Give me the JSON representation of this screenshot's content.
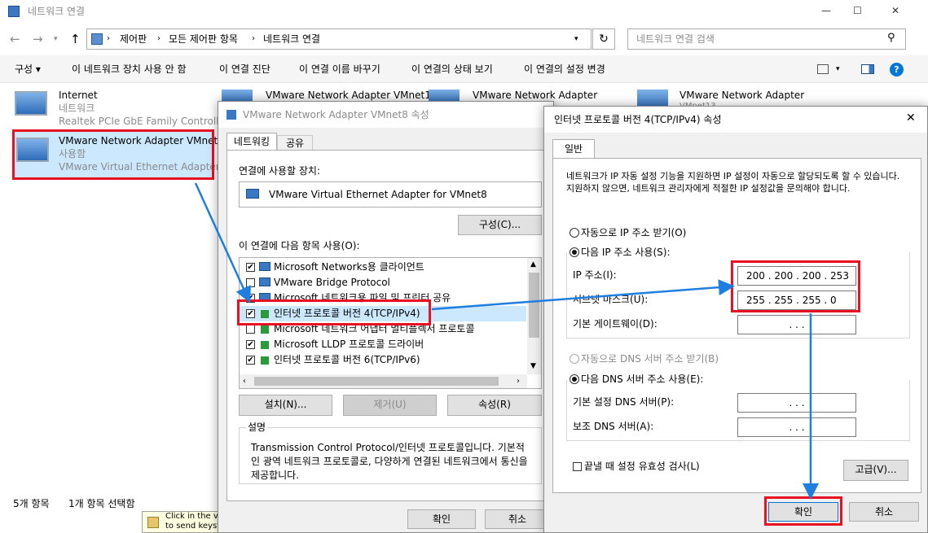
{
  "window": {
    "title": "네트워크 연결",
    "min": "—",
    "max": "☐",
    "close": "✕"
  },
  "address": {
    "path": [
      "제어판",
      "모든 제어판 항목",
      "네트워크 연결"
    ],
    "search_placeholder": "네트워크 연결 검색"
  },
  "commands": [
    "구성 ▾",
    "이 네트워크 장치 사용 안 함",
    "이 연결 진단",
    "이 연결 이름 바꾸기",
    "이 연결의 상태 보기",
    "이 연결의 설정 변경"
  ],
  "adapters": [
    {
      "name": "Internet",
      "status": "네트워크",
      "device": "Realtek PCIe GbE Family Controller"
    },
    {
      "name": "VMware Network Adapter VMnet8",
      "status": "사용함",
      "device": "VMware Virtual Ethernet Adapter..."
    },
    {
      "name": "VMware Network Adapter VMnet1"
    },
    {
      "name": "VMware Network Adapter"
    },
    {
      "name": "VMware Network Adapter",
      "extra": "VMnet13"
    }
  ],
  "statusbar": {
    "count": "5개 항목",
    "selected": "1개 항목 선택함"
  },
  "taskbar_text": {
    "line1": "Click in the vi",
    "line2": "to send keyst"
  },
  "props": {
    "title": "VMware Network Adapter VMnet8 속성",
    "tabs": [
      "네트워킹",
      "공유"
    ],
    "connect_using_label": "연결에 사용할 장치:",
    "device": "VMware Virtual Ethernet Adapter for VMnet8",
    "configure": "구성(C)...",
    "items_label": "이 연결에 다음 항목 사용(O):",
    "items": [
      {
        "label": "Microsoft Networks용 클라이언트",
        "checked": "✔"
      },
      {
        "label": "VMware Bridge Protocol",
        "checked": ""
      },
      {
        "label": "Microsoft 네트워크용 파일 및 프린터 공유",
        "checked": "✔"
      },
      {
        "label": "인터넷 프로토콜 버전 4(TCP/IPv4)",
        "checked": "✔"
      },
      {
        "label": "Microsoft 네트워크 어댑터 멀티플렉서 프로토콜",
        "checked": ""
      },
      {
        "label": "Microsoft LLDP 프로토콜 드라이버",
        "checked": "✔"
      },
      {
        "label": "인터넷 프로토콜 버전 6(TCP/IPv6)",
        "checked": "✔"
      }
    ],
    "install": "설치(N)...",
    "uninstall": "제거(U)",
    "properties": "속성(R)",
    "desc_label": "설명",
    "desc": "Transmission Control Protocol/인터넷 프로토콜입니다. 기본적인 광역 네트워크 프로토콜로, 다양하게 연결된 네트워크에서 통신을 제공합니다.",
    "ok": "확인",
    "cancel": "취소"
  },
  "ipv4": {
    "title": "인터넷 프로토콜 버전 4(TCP/IPv4) 속성",
    "tab": "일반",
    "intro": "네트워크가 IP 자동 설정 기능을 지원하면 IP 설정이 자동으로 할당되도록 할 수 있습니다. 지원하지 않으면, 네트워크 관리자에게 적절한 IP 설정값을 문의해야 합니다.",
    "auto_ip": "자동으로 IP 주소 받기(O)",
    "manual_ip": "다음 IP 주소 사용(S):",
    "ip_label": "IP 주소(I):",
    "ip_value": "200 . 200 . 200 . 253",
    "mask_label": "서브넷 마스크(U):",
    "mask_value": "255 . 255 . 255 .  0",
    "gw_label": "기본 게이트웨이(D):",
    "empty_ip": ".      .      .",
    "auto_dns": "자동으로 DNS 서버 주소 받기(B)",
    "manual_dns": "다음 DNS 서버 주소 사용(E):",
    "dns1_label": "기본 설정 DNS 서버(P):",
    "dns2_label": "보조 DNS 서버(A):",
    "validate": "끝낼 때 설정 유효성 검사(L)",
    "advanced": "고급(V)...",
    "ok": "확인",
    "cancel": "취소",
    "close": "✕"
  },
  "colors": {
    "accent": "#0078d7",
    "highlight": "#e81123",
    "arrow": "#1e7fe0"
  }
}
